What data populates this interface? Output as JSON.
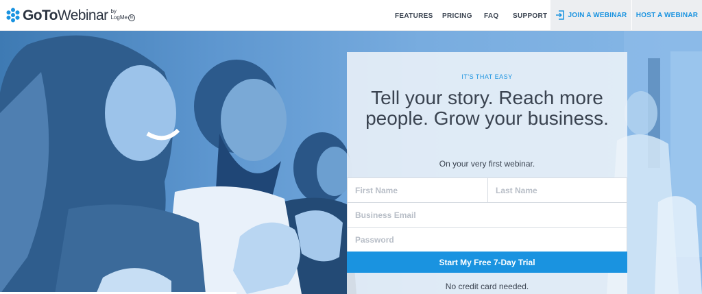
{
  "brand": {
    "name_bold": "GoTo",
    "name_light": "Webinar",
    "by": "by",
    "parent": "LogMe",
    "parent_suffix": "In"
  },
  "nav": {
    "features": "FEATURES",
    "pricing": "PRICING",
    "faq": "FAQ",
    "support": "SUPPORT",
    "join": "JOIN A WEBINAR",
    "host": "HOST A WEBINAR"
  },
  "signup": {
    "eyebrow": "IT'S THAT EASY",
    "headline": "Tell your story. Reach more people. Grow your business.",
    "subline": "On your very first webinar.",
    "first_name_placeholder": "First Name",
    "last_name_placeholder": "Last Name",
    "email_placeholder": "Business Email",
    "password_placeholder": "Password",
    "submit_label": "Start My Free 7-Day Trial",
    "note": "No credit card needed."
  },
  "colors": {
    "accent": "#1a93e0",
    "text_dark": "#3a4350",
    "hero_tint": "#5d96cf"
  },
  "icons": {
    "logo": "goto-snowflake-icon",
    "join": "sign-in-icon"
  }
}
